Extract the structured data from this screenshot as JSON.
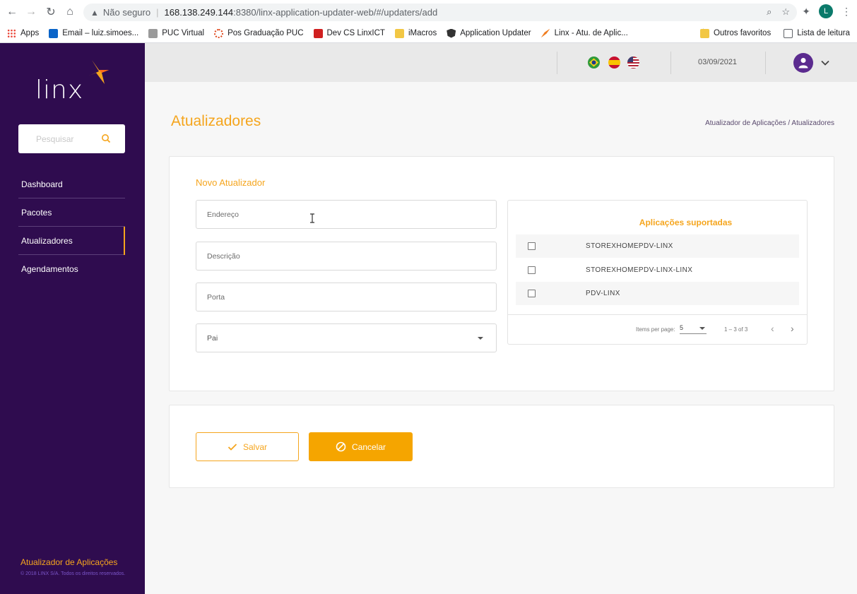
{
  "browser": {
    "security_label": "Não seguro",
    "url_host": "168.138.249.144",
    "url_path": ":8380/linx-application-updater-web/#/updaters/add",
    "profile_initial": "L",
    "bookmarks": [
      {
        "label": "Apps",
        "color": "#4285f4"
      },
      {
        "label": "Email – luiz.simoes...",
        "color": "#0a64c8"
      },
      {
        "label": "PUC Virtual",
        "color": "#8a8a8a"
      },
      {
        "label": "Pos Graduação PUC",
        "color": "#e04a1f"
      },
      {
        "label": "Dev CS LinxICT",
        "color": "#d02020"
      },
      {
        "label": "iMacros",
        "color": "#f2c744"
      },
      {
        "label": "Application Updater",
        "color": "#333333"
      },
      {
        "label": "Linx - Atu. de Aplic...",
        "color": "#f07c1e"
      }
    ],
    "other_bookmarks": "Outros favoritos",
    "reading_list": "Lista de leitura"
  },
  "sidebar": {
    "logo_text": "linx",
    "search_placeholder": "Pesquisar",
    "items": [
      {
        "label": "Dashboard"
      },
      {
        "label": "Pacotes"
      },
      {
        "label": "Atualizadores"
      },
      {
        "label": "Agendamentos"
      }
    ],
    "footer_title": "Atualizador de Aplicações",
    "footer_copy": "© 2018 LINX S/A. Todos os direitos reservados."
  },
  "header": {
    "date": "03/09/2021"
  },
  "page": {
    "title": "Atualizadores",
    "breadcrumb": "Atualizador de Aplicações / Atualizadores"
  },
  "form": {
    "subtitle": "Novo Atualizador",
    "address_placeholder": "Endereço",
    "description_placeholder": "Descrição",
    "port_placeholder": "Porta",
    "parent_label": "Pai"
  },
  "apps": {
    "title": "Aplicações suportadas",
    "rows": [
      {
        "name": "STOREXHOMEPDV-LINX"
      },
      {
        "name": "STOREXHOMEPDV-LINX-LINX"
      },
      {
        "name": "PDV-LINX"
      }
    ],
    "items_per_page_label": "Items per page:",
    "page_size": "5",
    "range": "1 – 3 of 3"
  },
  "actions": {
    "save_label": "Salvar",
    "cancel_label": "Cancelar"
  },
  "colors": {
    "accent": "#f5a51d",
    "sidebar_bg": "#2f0c4f"
  }
}
